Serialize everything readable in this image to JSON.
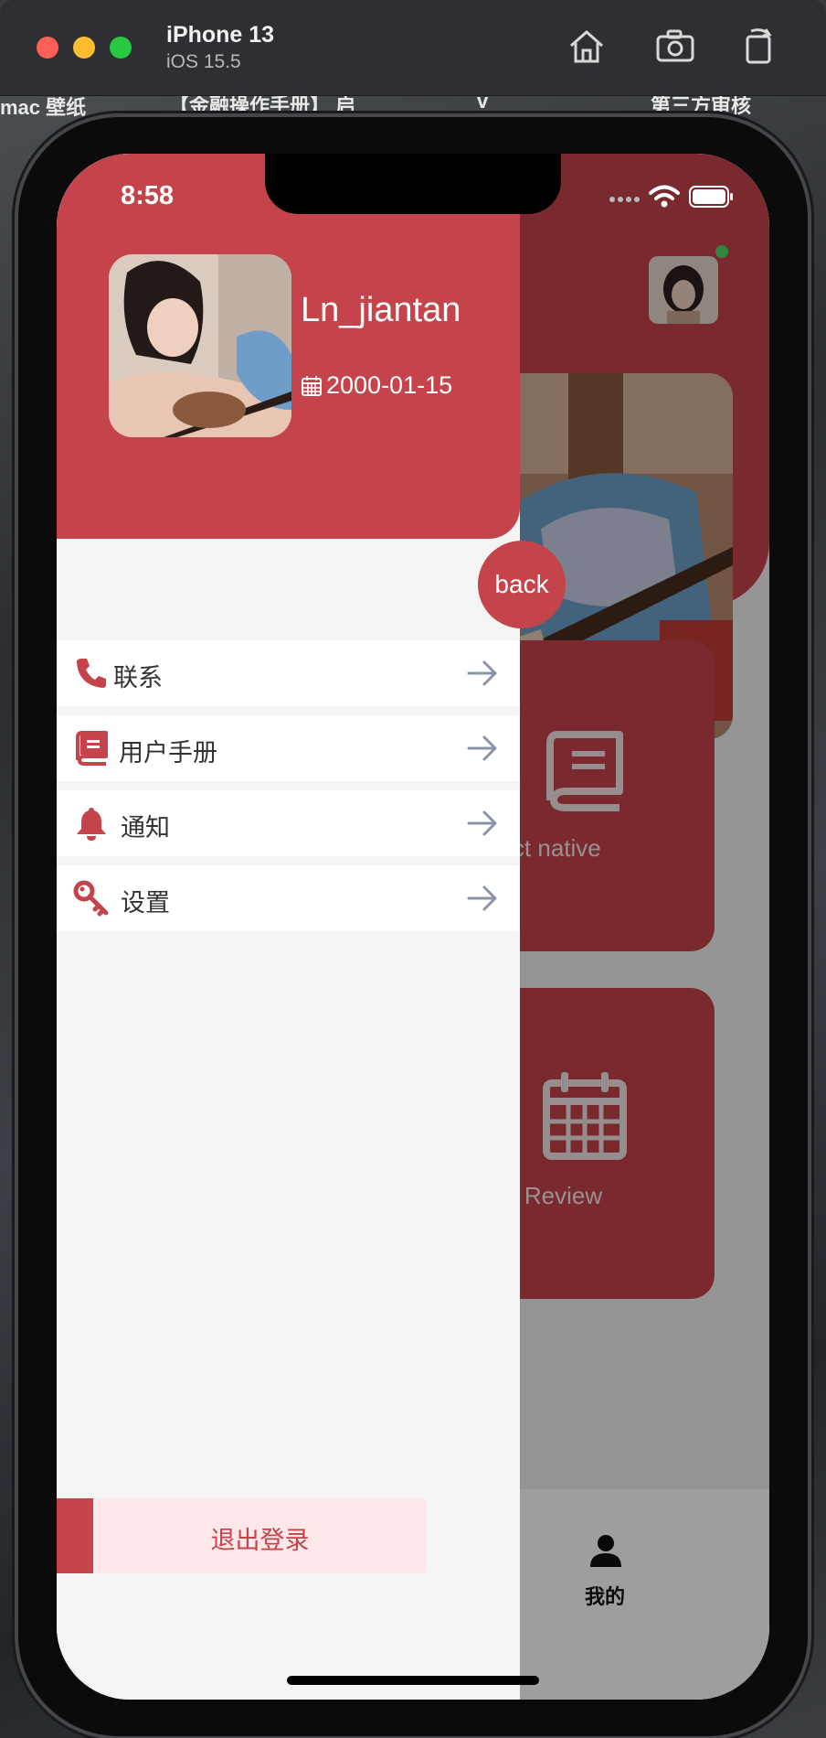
{
  "simulator": {
    "device_name": "iPhone 13",
    "os_version": "iOS 15.5",
    "buttons": [
      "home-icon",
      "screenshot-icon",
      "rotate-icon"
    ]
  },
  "desktop": {
    "fragments": [
      "mac 壁纸",
      "【金融操作手册】 启",
      "v",
      "第三方审核"
    ]
  },
  "status_bar": {
    "time": "8:58"
  },
  "drawer": {
    "username": "Ln_jiantan",
    "birthday": "2000-01-15",
    "back_label": "back",
    "menu": [
      {
        "label": "联系",
        "icon": "phone-icon"
      },
      {
        "label": "用户手册",
        "icon": "book-icon"
      },
      {
        "label": "通知",
        "icon": "bell-icon"
      },
      {
        "label": "设置",
        "icon": "key-icon"
      }
    ],
    "logout_label": "退出登录"
  },
  "main": {
    "cards": [
      {
        "label": "eact native",
        "icon": "book-icon"
      },
      {
        "label": "My Review",
        "icon": "calendar-icon"
      }
    ],
    "tab_label": "我的"
  },
  "colors": {
    "brand_red": "#c5444b",
    "logout_bg": "#fde7e8",
    "arrow_gray": "#8a94a6"
  }
}
